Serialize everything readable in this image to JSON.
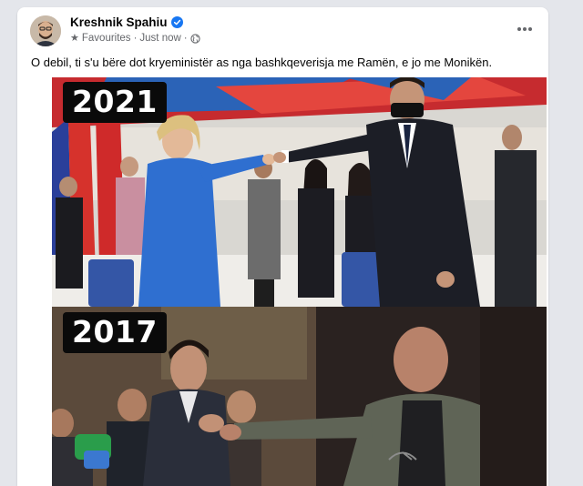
{
  "post": {
    "author": "Kreshnik Spahiu",
    "audience_label": "Favourites",
    "separator": "·",
    "time": "Just now",
    "text": "O debil, ti s'u bëre dot kryeministër as nga bashkqeverisja me Ramën, e jo me Monikën.",
    "icons": {
      "verified": "verified-badge-icon",
      "audience": "star-icon",
      "privacy": "globe-icon",
      "menu": "more-options-icon"
    },
    "colors": {
      "verified": "#1877f2",
      "secondary_text": "#65676b",
      "primary_text": "#050505"
    }
  },
  "media": {
    "top_panel_label": "2021",
    "bottom_panel_label": "2017"
  }
}
